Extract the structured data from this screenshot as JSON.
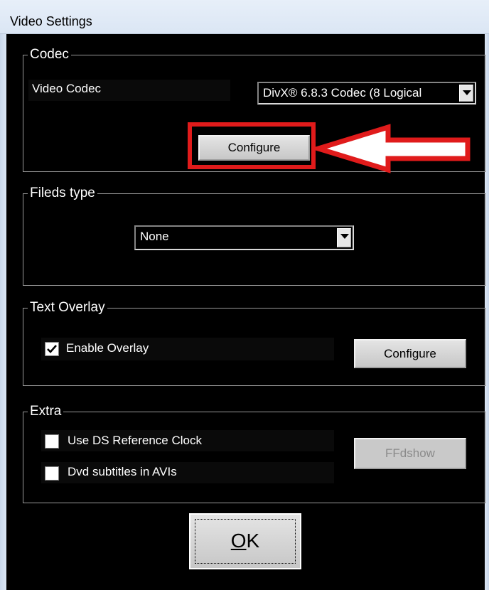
{
  "window": {
    "title": "Video Settings"
  },
  "codec": {
    "group_title": "Codec",
    "label": "Video Codec",
    "selected": "DivX® 6.8.3 Codec (8 Logical",
    "configure_label": "Configure"
  },
  "fields_type": {
    "group_title": "Fileds type",
    "selected": "None"
  },
  "text_overlay": {
    "group_title": "Text Overlay",
    "enable_label": "Enable Overlay",
    "enable_checked": true,
    "configure_label": "Configure"
  },
  "extra": {
    "group_title": "Extra",
    "ds_clock_label": "Use DS Reference Clock",
    "ds_clock_checked": false,
    "dvd_subs_label": "Dvd subtitles in AVIs",
    "dvd_subs_checked": false,
    "ffdshow_label": "FFdshow"
  },
  "ok": {
    "label": "OK",
    "underlined": "O",
    "rest": "K"
  },
  "annotation": {
    "highlight_color": "#e01b1b",
    "arrow_color": "#e01b1b"
  }
}
